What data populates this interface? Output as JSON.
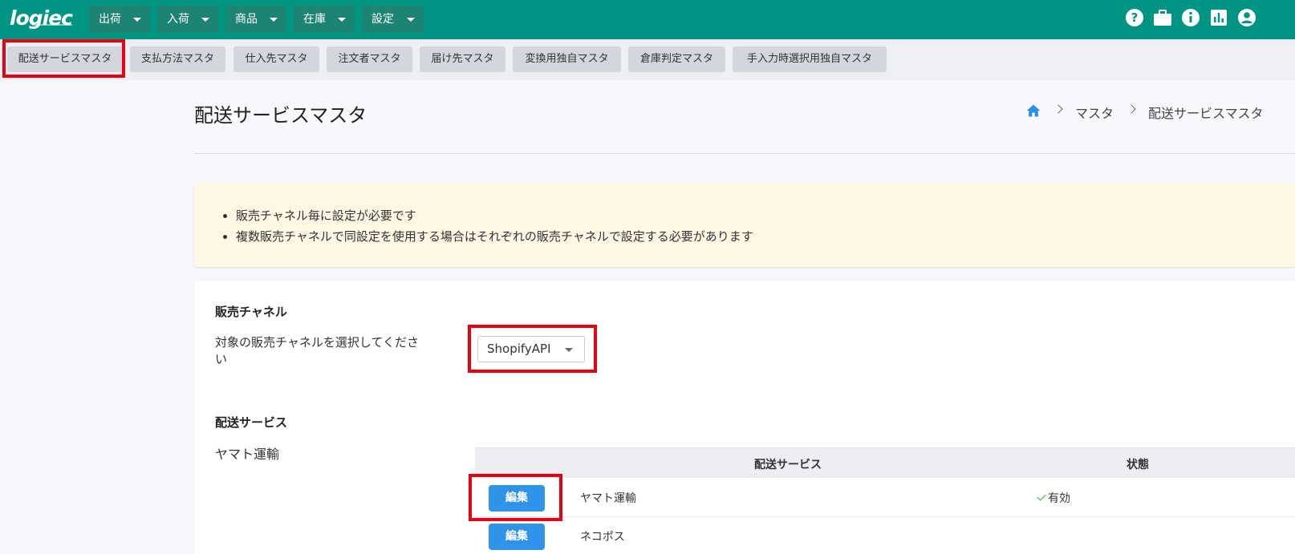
{
  "app": {
    "logo": "logiec"
  },
  "nav": {
    "menus": [
      "出荷",
      "入荷",
      "商品",
      "在庫",
      "設定"
    ],
    "icons": [
      "help-icon",
      "briefcase-icon",
      "info-icon",
      "chart-icon",
      "account-icon"
    ]
  },
  "subtabs": [
    "配送サービスマスタ",
    "支払方法マスタ",
    "仕入先マスタ",
    "注文者マスタ",
    "届け先マスタ",
    "変換用独自マスタ",
    "倉庫判定マスタ",
    "手入力時選択用独自マスタ"
  ],
  "page": {
    "title": "配送サービスマスタ",
    "breadcrumb": [
      "マスタ",
      "配送サービスマスタ"
    ]
  },
  "notice": {
    "items": [
      "販売チャネル毎に設定が必要です",
      "複数販売チャネルで同設定を使用する場合はそれぞれの販売チャネルで設定する必要があります"
    ]
  },
  "channel": {
    "section_title": "販売チャネル",
    "label_line1": "対象の販売チャネルを選択してくださ",
    "label_line2": "い",
    "selected": "ShopifyAPI"
  },
  "delivery": {
    "section_title": "配送サービス",
    "carrier": "ヤマト運輸",
    "columns": [
      "配送サービス",
      "状態"
    ],
    "edit_label": "編集",
    "rows": [
      {
        "service": "ヤマト運輸",
        "status": "有効"
      },
      {
        "service": "ネコポス",
        "status": ""
      }
    ]
  },
  "colors": {
    "topbar": "#009582",
    "highlight": "#e50012",
    "primary_button": "#2f93ea",
    "notice_bg": "#fdf7e4"
  }
}
